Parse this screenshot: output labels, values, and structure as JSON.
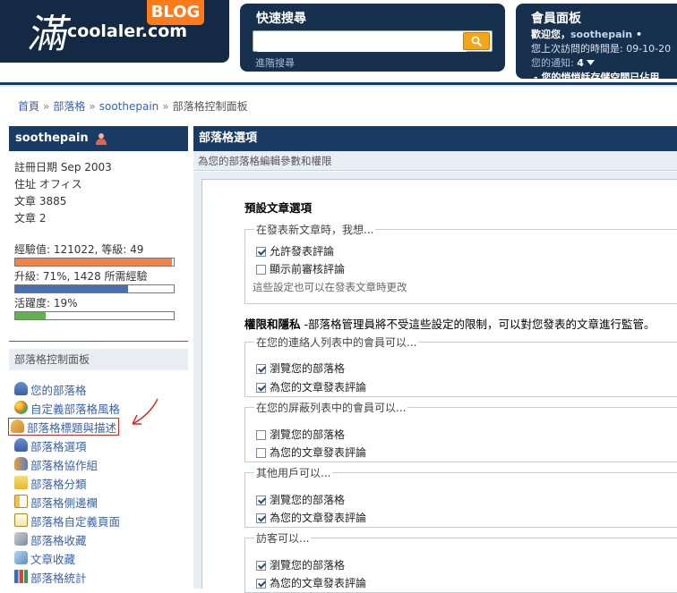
{
  "header": {
    "logo_glyph": "滿",
    "site_name": "coolaler.com",
    "blog_badge": "BLOG",
    "quick_search": {
      "title": "快速搜尋",
      "placeholder": "",
      "advanced_link": "進階搜尋"
    },
    "member_panel": {
      "title": "會員面板",
      "welcome": "歡迎您，",
      "username": "soothepain",
      "last_visit": "您上次訪問的時間是: 09-10-20",
      "notifications_label": "您的通知: ",
      "notifications_count": "4",
      "storage_warning": "- 您的悄悄話存儲空間已佔用"
    }
  },
  "breadcrumb": [
    "首頁",
    "部落格",
    "soothepain",
    "部落格控制面板"
  ],
  "sidebar": {
    "username": "soothepain",
    "info": [
      "註冊日期 Sep 2003",
      "住址 オフィス",
      "文章 3885",
      "文章 2"
    ],
    "experience": {
      "label": "經驗值: 121022, 等級: 49",
      "level": 0.99
    },
    "upgrade": {
      "label": "升級: 71%, 1428 所需經驗",
      "level": 0.71
    },
    "activity": {
      "label": "活躍度: 19%",
      "level": 0.19
    },
    "panel_title": "部落格控制面板",
    "nav": [
      {
        "label": "您的部落格"
      },
      {
        "label": "自定義部落格風格"
      },
      {
        "label": "部落格標題與描述"
      },
      {
        "label": "部落格選項"
      },
      {
        "label": "部落格協作組"
      },
      {
        "label": "部落格分類"
      },
      {
        "label": "部落格側邊欄"
      },
      {
        "label": "部落格自定義頁面"
      },
      {
        "label": "部落格收藏"
      },
      {
        "label": "文章收藏"
      },
      {
        "label": "部落格統計"
      }
    ]
  },
  "main": {
    "title": "部落格選項",
    "subtitle": "為您的部落格編輯參數和權限",
    "default_options": {
      "title": "預設文章選項",
      "group_legend": "在發表新文章時，我想...",
      "options": [
        {
          "label": "允許發表評論",
          "checked": true
        },
        {
          "label": "顯示前審核評論",
          "checked": false
        }
      ],
      "note": "這些設定也可以在發表文章時更改"
    },
    "permissions": {
      "title": "權限和隱私",
      "description": " -部落格管理員將不受這些設定的限制，可以對您發表的文章進行監管。",
      "groups": [
        {
          "legend": "在您的連絡人列表中的會員可以...",
          "options": [
            {
              "label": "瀏覽您的部落格",
              "checked": true
            },
            {
              "label": "為您的文章發表評論",
              "checked": true
            }
          ]
        },
        {
          "legend": "在您的屏蔽列表中的會員可以...",
          "options": [
            {
              "label": "瀏覽您的部落格",
              "checked": false
            },
            {
              "label": "為您的文章發表評論",
              "checked": false
            }
          ]
        },
        {
          "legend": "其他用戶可以...",
          "options": [
            {
              "label": "瀏覽您的部落格",
              "checked": true
            },
            {
              "label": "為您的文章發表評論",
              "checked": true
            }
          ]
        },
        {
          "legend": "訪客可以...",
          "options": [
            {
              "label": "瀏覽您的部落格",
              "checked": true
            },
            {
              "label": "為您的文章發表評論",
              "checked": true
            }
          ]
        }
      ]
    }
  },
  "colors": {
    "header_navy": "#16304d",
    "accent_orange": "#ff7a18",
    "link_blue": "#3a63a8",
    "bar_experience": "#f2824a",
    "bar_upgrade": "#4a6fb3",
    "bar_activity": "#5fb34a",
    "highlight_red": "#d9261c"
  }
}
